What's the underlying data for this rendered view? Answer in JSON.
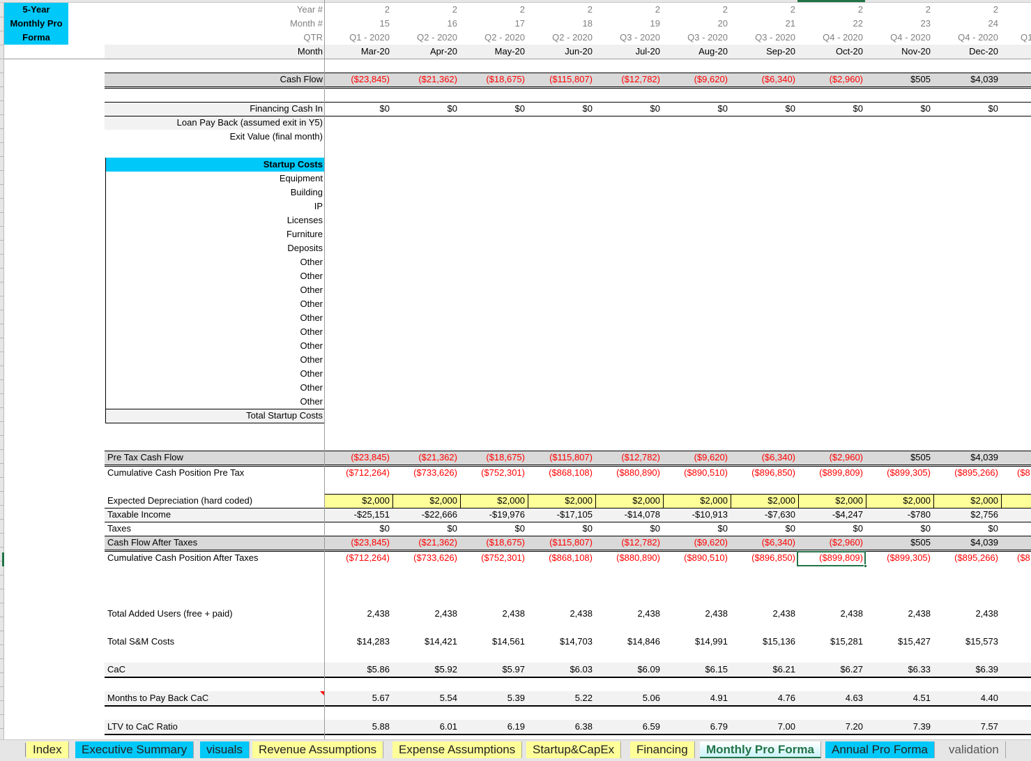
{
  "sheet": {
    "title_block": [
      "5-Year",
      "Monthly Pro",
      "Forma"
    ],
    "header_labels": {
      "year": "Year #",
      "month_num": "Month #",
      "qtr": "QTR",
      "month": "Month"
    },
    "columns": [
      {
        "year": "2",
        "month_num": "15",
        "qtr": "Q1 - 2020",
        "month": "Mar-20"
      },
      {
        "year": "2",
        "month_num": "16",
        "qtr": "Q2 - 2020",
        "month": "Apr-20"
      },
      {
        "year": "2",
        "month_num": "17",
        "qtr": "Q2 - 2020",
        "month": "May-20"
      },
      {
        "year": "2",
        "month_num": "18",
        "qtr": "Q2 - 2020",
        "month": "Jun-20"
      },
      {
        "year": "2",
        "month_num": "19",
        "qtr": "Q3 - 2020",
        "month": "Jul-20"
      },
      {
        "year": "2",
        "month_num": "20",
        "qtr": "Q3 - 2020",
        "month": "Aug-20"
      },
      {
        "year": "2",
        "month_num": "21",
        "qtr": "Q3 - 2020",
        "month": "Sep-20"
      },
      {
        "year": "2",
        "month_num": "22",
        "qtr": "Q4 - 2020",
        "month": "Oct-20"
      },
      {
        "year": "2",
        "month_num": "23",
        "qtr": "Q4 - 2020",
        "month": "Nov-20"
      },
      {
        "year": "2",
        "month_num": "24",
        "qtr": "Q4 - 2020",
        "month": "Dec-20"
      }
    ],
    "partial_next_qtr": "Q1",
    "cash_flow": {
      "label": "Cash Flow",
      "values": [
        "($23,845)",
        "($21,362)",
        "($18,675)",
        "($115,807)",
        "($12,782)",
        "($9,620)",
        "($6,340)",
        "($2,960)",
        "$505",
        "$4,039"
      ],
      "negative": [
        true,
        true,
        true,
        true,
        true,
        true,
        true,
        true,
        false,
        false
      ]
    },
    "financing": {
      "cash_in_label": "Financing Cash In",
      "cash_in_values": [
        "$0",
        "$0",
        "$0",
        "$0",
        "$0",
        "$0",
        "$0",
        "$0",
        "$0",
        "$0"
      ],
      "loan_payback_label": "Loan Pay Back (assumed exit in Y5)",
      "exit_value_label": "Exit Value (final month)"
    },
    "startup_costs": {
      "header": "Startup Costs",
      "items": [
        "Equipment",
        "Building",
        "IP",
        "Licenses",
        "Furniture",
        "Deposits",
        "Other",
        "Other",
        "Other",
        "Other",
        "Other",
        "Other",
        "Other",
        "Other",
        "Other",
        "Other",
        "Other"
      ],
      "total_label": "Total Startup Costs"
    },
    "pre_tax": {
      "label": "Pre Tax Cash Flow",
      "values": [
        "($23,845)",
        "($21,362)",
        "($18,675)",
        "($115,807)",
        "($12,782)",
        "($9,620)",
        "($6,340)",
        "($2,960)",
        "$505",
        "$4,039"
      ],
      "cumulative_label": "Cumulative Cash Position Pre Tax",
      "cumulative_values": [
        "($712,264)",
        "($733,626)",
        "($752,301)",
        "($868,108)",
        "($880,890)",
        "($890,510)",
        "($896,850)",
        "($899,809)",
        "($899,305)",
        "($895,266)"
      ],
      "cumulative_partial": "($8"
    },
    "taxes": {
      "depreciation_label": "Expected Depreciation (hard coded)",
      "depreciation_values": [
        "$2,000",
        "$2,000",
        "$2,000",
        "$2,000",
        "$2,000",
        "$2,000",
        "$2,000",
        "$2,000",
        "$2,000",
        "$2,000"
      ],
      "taxable_label": "Taxable Income",
      "taxable_values": [
        "-$25,151",
        "-$22,666",
        "-$19,976",
        "-$17,105",
        "-$14,078",
        "-$10,913",
        "-$7,630",
        "-$4,247",
        "-$780",
        "$2,756"
      ],
      "taxes_label": "Taxes",
      "taxes_values": [
        "$0",
        "$0",
        "$0",
        "$0",
        "$0",
        "$0",
        "$0",
        "$0",
        "$0",
        "$0"
      ],
      "after_tax_label": "Cash Flow After Taxes",
      "after_tax_values": [
        "($23,845)",
        "($21,362)",
        "($18,675)",
        "($115,807)",
        "($12,782)",
        "($9,620)",
        "($6,340)",
        "($2,960)",
        "$505",
        "$4,039"
      ],
      "cumulative_after_label": "Cumulative Cash Position After Taxes",
      "cumulative_after_values": [
        "($712,264)",
        "($733,626)",
        "($752,301)",
        "($868,108)",
        "($880,890)",
        "($890,510)",
        "($896,850)",
        "($899,809)",
        "($899,305)",
        "($895,266)"
      ],
      "cumulative_after_partial": "($8"
    },
    "metrics": {
      "users_label": "Total Added Users (free + paid)",
      "users_values": [
        "2,438",
        "2,438",
        "2,438",
        "2,438",
        "2,438",
        "2,438",
        "2,438",
        "2,438",
        "2,438",
        "2,438"
      ],
      "sm_label": "Total S&M Costs",
      "sm_values": [
        "$14,283",
        "$14,421",
        "$14,561",
        "$14,703",
        "$14,846",
        "$14,991",
        "$15,136",
        "$15,281",
        "$15,427",
        "$15,573"
      ],
      "cac_label": "CaC",
      "cac_values": [
        "$5.86",
        "$5.92",
        "$5.97",
        "$6.03",
        "$6.09",
        "$6.15",
        "$6.21",
        "$6.27",
        "$6.33",
        "$6.39"
      ],
      "payback_label": "Months to Pay Back CaC",
      "payback_values": [
        "5.67",
        "5.54",
        "5.39",
        "5.22",
        "5.06",
        "4.91",
        "4.76",
        "4.63",
        "4.51",
        "4.40"
      ],
      "ltv_label": "LTV to CaC Ratio",
      "ltv_values": [
        "5.88",
        "6.01",
        "6.19",
        "6.38",
        "6.59",
        "6.79",
        "7.00",
        "7.20",
        "7.39",
        "7.57"
      ]
    },
    "selected_cell": {
      "row": "Cumulative Cash Position After Taxes",
      "column": "Oct-20"
    }
  },
  "tabs": [
    {
      "label": "Index",
      "color": "yellow"
    },
    {
      "label": "Executive Summary",
      "color": "cyan"
    },
    {
      "label": "visuals",
      "color": "cyan"
    },
    {
      "label": "Revenue Assumptions",
      "color": "yellow"
    },
    {
      "label": "Expense Assumptions",
      "color": "yellow"
    },
    {
      "label": "Startup&CapEx",
      "color": "yellow"
    },
    {
      "label": "Financing",
      "color": "yellow"
    },
    {
      "label": "Monthly Pro Forma",
      "color": "active"
    },
    {
      "label": "Annual Pro Forma",
      "color": "cyan"
    },
    {
      "label": "validation",
      "color": "none"
    }
  ],
  "colors": {
    "accent_cyan": "#00c8f8",
    "negative_red": "#ff0000",
    "input_yellow": "#ffff99",
    "excel_green": "#217346"
  }
}
